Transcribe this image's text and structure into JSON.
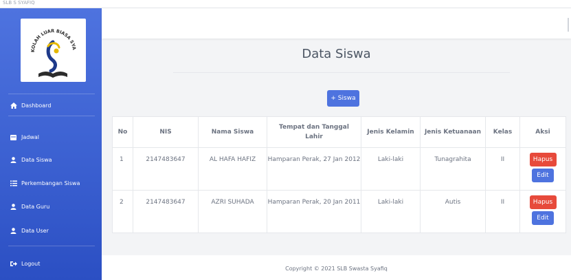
{
  "window": {
    "top_text": "SLB S SYAFIQ"
  },
  "logo": {
    "text": "SEKOLAH LUAR BIASA SYAFIQ"
  },
  "sidebar": {
    "items": [
      {
        "label": "Dashboard",
        "icon": "home-icon"
      },
      {
        "label": "Jadwal",
        "icon": "calendar-icon"
      },
      {
        "label": "Data Siswa",
        "icon": "user-icon"
      },
      {
        "label": "Perkembangan Siswa",
        "icon": "list-icon"
      },
      {
        "label": "Data Guru",
        "icon": "user-icon"
      },
      {
        "label": "Data User",
        "icon": "user-icon"
      },
      {
        "label": "Logout",
        "icon": "logout-icon"
      }
    ]
  },
  "main": {
    "title": "Data Siswa",
    "add_button": "+ Siswa",
    "table": {
      "headers": [
        "No",
        "NIS",
        "Nama Siswa",
        "Tempat dan Tanggal Lahir",
        "Jenis Kelamin",
        "Jenis Ketuanaan",
        "Kelas",
        "Aksi"
      ],
      "rows": [
        {
          "no": "1",
          "nis": "2147483647",
          "nama": "AL HAFA HAFIZ",
          "ttl": "Hamparan Perak, 27 Jan 2012",
          "jk": "Laki-laki",
          "ketunaan": "Tunagrahita",
          "kelas": "II"
        },
        {
          "no": "2",
          "nis": "2147483647",
          "nama": "AZRI SUHADA",
          "ttl": "Hamparan Perak, 20 Jan 2011",
          "jk": "Laki-laki",
          "ketunaan": "Autis",
          "kelas": "II"
        }
      ],
      "delete_label": "Hapus",
      "edit_label": "Edit"
    }
  },
  "footer": {
    "text": "Copyright © 2021 SLB Swasta Syafiq"
  },
  "colors": {
    "sidebar": "#4e73df",
    "primary": "#4e73df",
    "danger": "#e74a3b",
    "background": "#f3f4f6"
  }
}
